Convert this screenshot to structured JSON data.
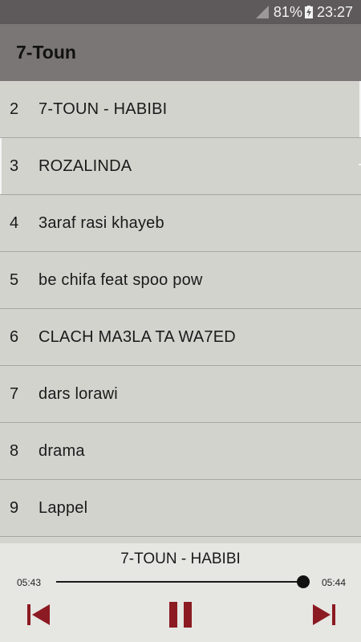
{
  "status_bar": {
    "battery": "81%",
    "time": "23:27"
  },
  "app_bar": {
    "title": "7-Toun"
  },
  "tracks": [
    {
      "num": "2",
      "title": "7-TOUN - HABIBI"
    },
    {
      "num": "3",
      "title": "ROZALINDA"
    },
    {
      "num": "4",
      "title": "3araf rasi khayeb"
    },
    {
      "num": "5",
      "title": "be chifa feat spoo pow"
    },
    {
      "num": "6",
      "title": "CLACH MA3LA TA WA7ED"
    },
    {
      "num": "7",
      "title": "dars lorawi"
    },
    {
      "num": "8",
      "title": "drama"
    },
    {
      "num": "9",
      "title": "Lappel"
    }
  ],
  "player": {
    "now_playing": "7-TOUN - HABIBI",
    "current_time": "05:43",
    "total_time": "05:44",
    "progress": 0.997
  },
  "colors": {
    "accent": "#8b1a22",
    "app_bar": "#7b7676",
    "status_bar": "#5e5a5b"
  },
  "icons": [
    "signal-icon",
    "battery-charging-icon",
    "skip-previous-icon",
    "pause-icon",
    "skip-next-icon"
  ]
}
